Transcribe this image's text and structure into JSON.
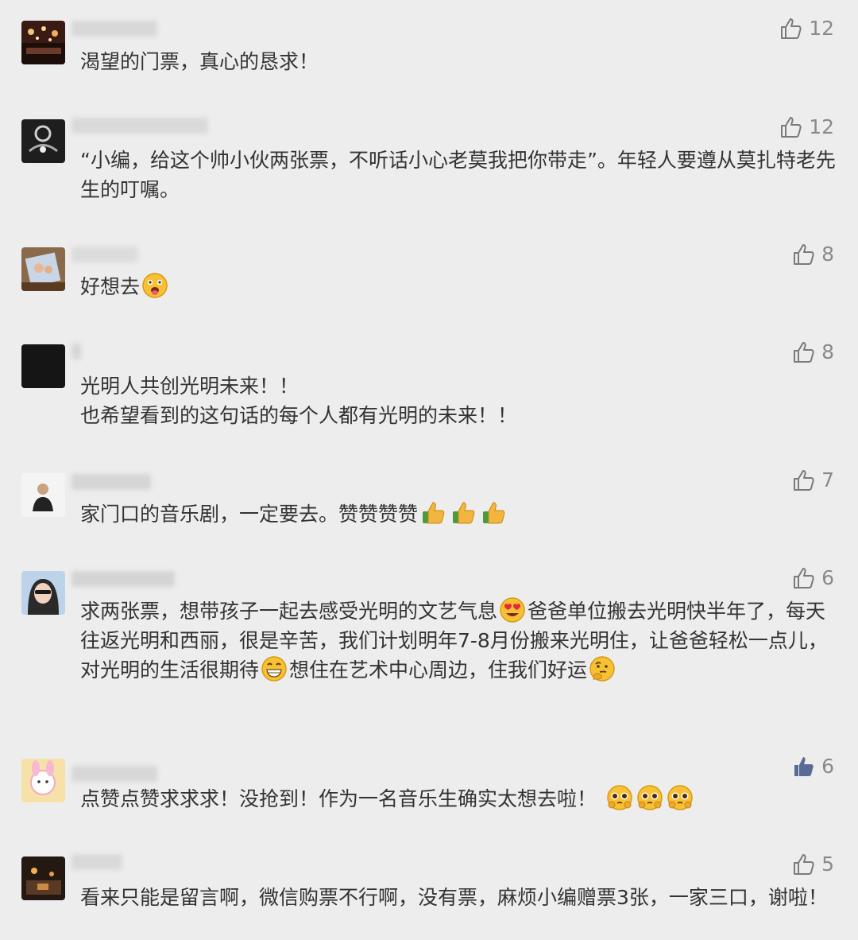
{
  "comments": [
    {
      "text": "渴望的门票，真心的恳求！",
      "likes": "12",
      "liked": false
    },
    {
      "text": "“小编，给这个帅小伙两张票，不听话小心老莫我把你带走”。年轻人要遵从莫扎特老先生的叮嘱。",
      "likes": "12",
      "liked": false
    },
    {
      "text": "好想去",
      "likes": "8",
      "liked": false,
      "emoji": "tongue-emoji"
    },
    {
      "text": "光明人共创光明未来！！\n也希望看到的这句话的每个人都有光明的未来！！",
      "likes": "8",
      "liked": false
    },
    {
      "text": "家门口的音乐剧，一定要去。赞赞赞赞",
      "likes": "7",
      "liked": false,
      "emoji": "thumbs-up-emoji x3"
    },
    {
      "text_parts": [
        "求两张票，想带孩子一起去感受光明的文艺气息",
        "爸爸单位搬去光明快半年了，每天往返光明和西丽，很是辛苦，我们计划明年7-8月份搬来光明住，让爸爸轻松一点儿，对光明的生活很期待",
        "想住在艺术中心周边，住我们好运"
      ],
      "likes": "6",
      "liked": false
    },
    {
      "text": "点赞点赞求求求！没抢到！作为一名音乐生确实太想去啦！",
      "likes": "6",
      "liked": true,
      "emoji": "pleading-emoji x3"
    },
    {
      "text": "看来只能是留言啊，微信购票不行啊，没有票，麻烦小编赠票3张，一家三口，谢啦！",
      "likes": "5",
      "liked": false
    }
  ],
  "colors": {
    "background": "#ededed",
    "text": "#333333",
    "like_count": "#8a8a8a",
    "like_icon": "#7a7a7a",
    "like_active": "#576b95"
  }
}
